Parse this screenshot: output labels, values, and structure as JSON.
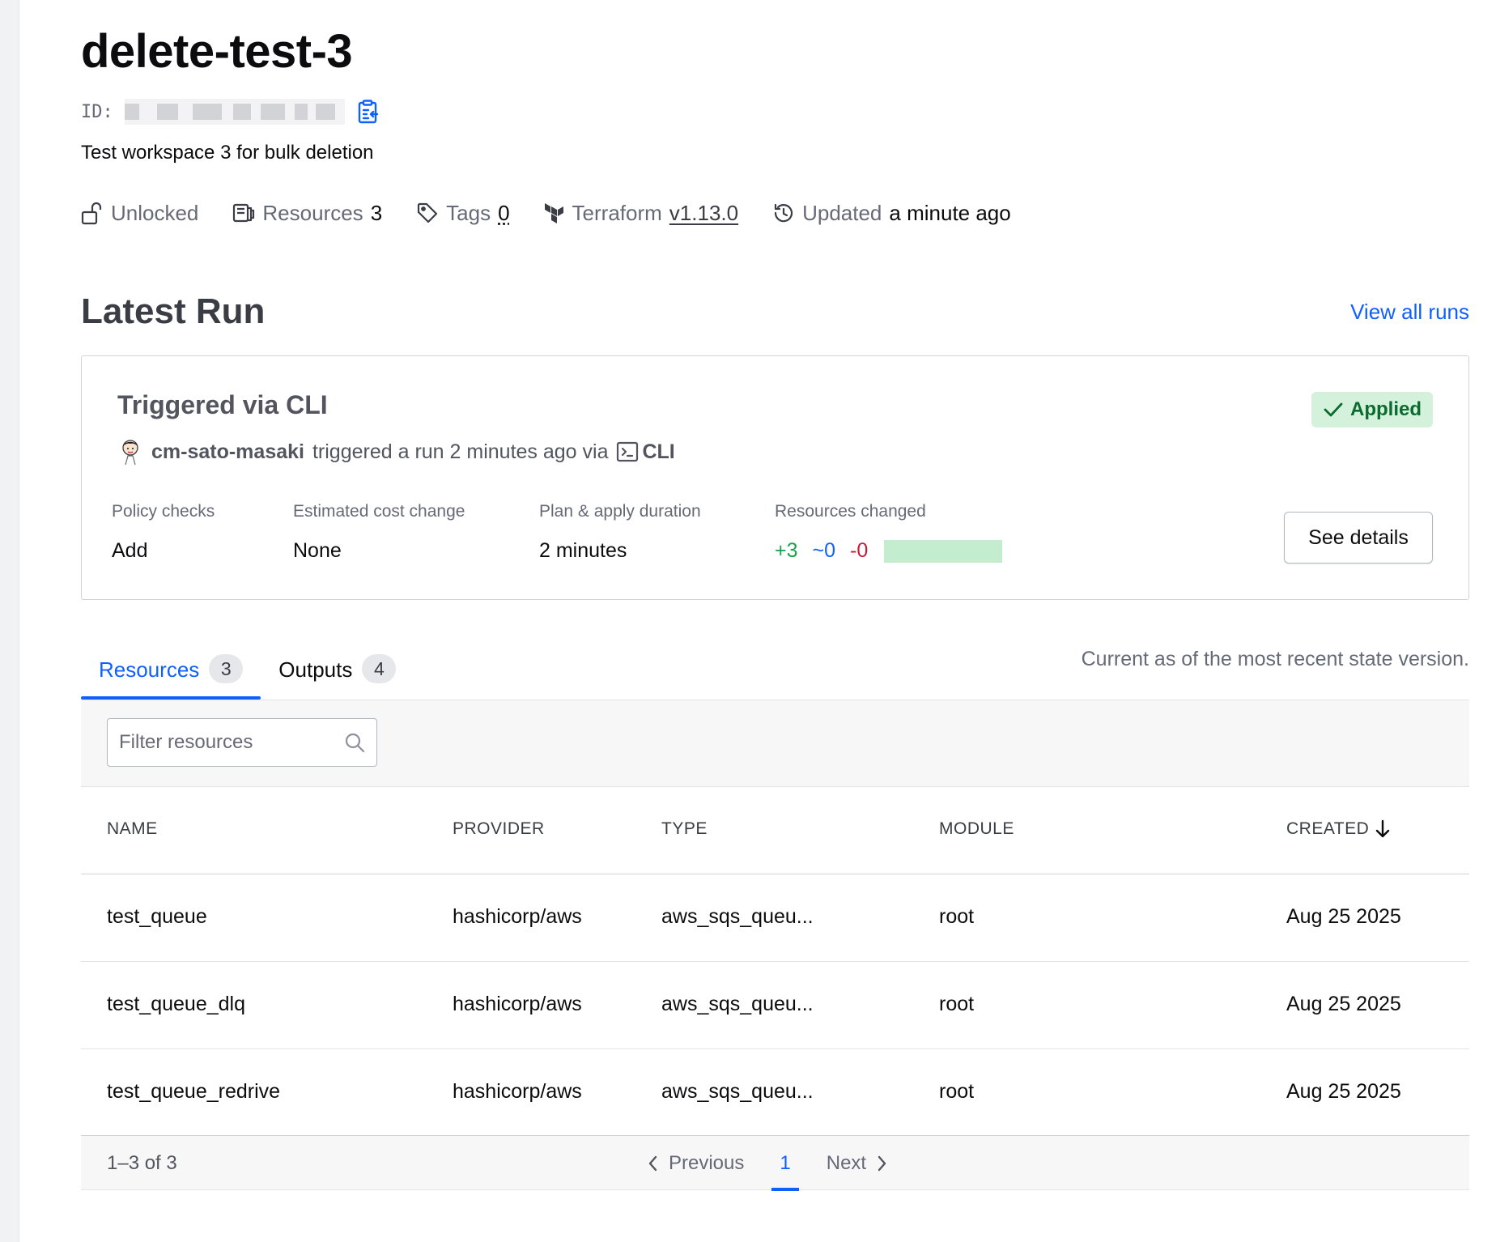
{
  "workspace": {
    "title": "delete-test-3",
    "id_label": "ID:",
    "description": "Test workspace 3 for bulk deletion"
  },
  "meta": {
    "lock_status": "Unlocked",
    "resources_label": "Resources",
    "resources_count": "3",
    "tags_label": "Tags",
    "tags_count": "0",
    "terraform_label": "Terraform",
    "terraform_version": "v1.13.0",
    "updated_label": "Updated",
    "updated_value": "a minute ago"
  },
  "latest_run": {
    "section_title": "Latest Run",
    "view_all_label": "View all runs",
    "title": "Triggered via CLI",
    "status": "Applied",
    "user": "cm-sato-masaki",
    "trigger_text": "triggered a run 2 minutes ago via",
    "source": "CLI",
    "stats": {
      "policy_label": "Policy checks",
      "policy_value": "Add",
      "cost_label": "Estimated cost change",
      "cost_value": "None",
      "duration_label": "Plan & apply duration",
      "duration_value": "2 minutes",
      "changes_label": "Resources changed",
      "added": "+3",
      "changed": "~0",
      "destroyed": "-0"
    },
    "see_details_label": "See details"
  },
  "tabs": [
    {
      "label": "Resources",
      "count": "3"
    },
    {
      "label": "Outputs",
      "count": "4"
    }
  ],
  "state_note": "Current as of the most recent state version.",
  "filter": {
    "placeholder": "Filter resources"
  },
  "table": {
    "headers": {
      "name": "NAME",
      "provider": "PROVIDER",
      "type": "TYPE",
      "module": "MODULE",
      "created": "CREATED"
    },
    "rows": [
      {
        "name": "test_queue",
        "provider": "hashicorp/aws",
        "type": "aws_sqs_queu...",
        "module": "root",
        "created": "Aug 25 2025"
      },
      {
        "name": "test_queue_dlq",
        "provider": "hashicorp/aws",
        "type": "aws_sqs_queu...",
        "module": "root",
        "created": "Aug 25 2025"
      },
      {
        "name": "test_queue_redrive",
        "provider": "hashicorp/aws",
        "type": "aws_sqs_queu...",
        "module": "root",
        "created": "Aug 25 2025"
      }
    ]
  },
  "pagination": {
    "summary": "1–3 of 3",
    "previous_label": "Previous",
    "current_page": "1",
    "next_label": "Next"
  },
  "colors": {
    "link_blue": "#1060ff",
    "success_bg": "#d4f1dc",
    "success_text": "#0b6a2d",
    "add_green": "#15a34a",
    "destroy_red": "#c41e3a"
  },
  "icons": {
    "copy": "clipboard-copy-icon",
    "lock": "unlock-icon",
    "resources": "resources-icon",
    "tags": "tag-icon",
    "terraform": "terraform-logo-icon",
    "updated": "history-icon",
    "status": "check-icon",
    "cli": "terminal-icon",
    "search": "search-icon",
    "sort": "arrow-down-icon",
    "prev": "chevron-left-icon",
    "next": "chevron-right-icon"
  }
}
